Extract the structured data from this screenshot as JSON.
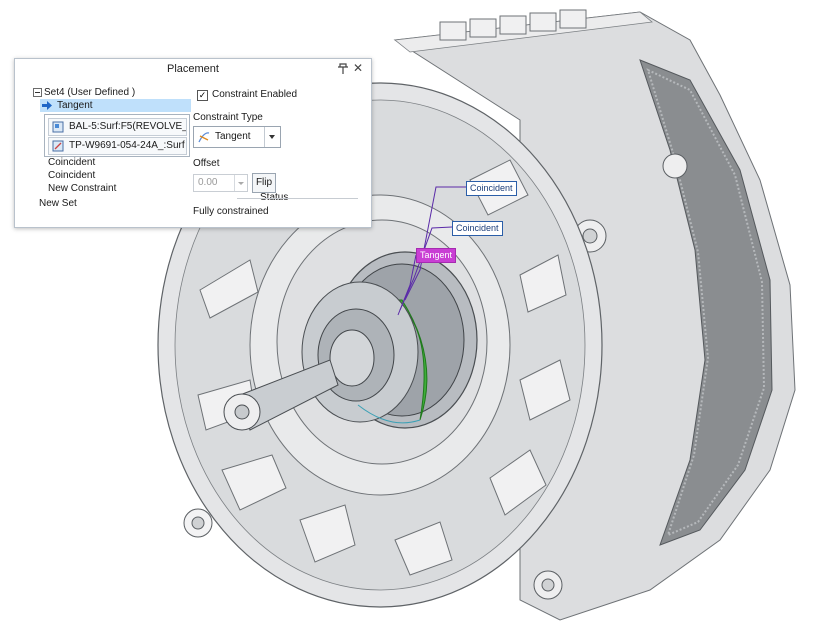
{
  "panel": {
    "title": "Placement",
    "tree": {
      "set_label": "Set4 (User Defined )",
      "selected_constraint": "Tangent",
      "references": [
        "BAL-5:Surf:F5(REVOLVE_",
        "TP-W9691-054-24A_:Surf"
      ],
      "other_constraints": [
        "Coincident",
        "Coincident",
        "New Constraint"
      ],
      "new_set": "New Set"
    },
    "constraint_enabled": {
      "label": "Constraint Enabled",
      "checked": true
    },
    "constraint_type": {
      "label": "Constraint Type",
      "value": "Tangent"
    },
    "offset": {
      "label": "Offset",
      "value": "0.00",
      "flip_label": "Flip"
    },
    "status": {
      "label": "Status",
      "value": "Fully constrained"
    }
  },
  "viewport": {
    "annotations": [
      {
        "label": "Coincident",
        "color": "#2b5ea8"
      },
      {
        "label": "Coincident",
        "color": "#2b5ea8"
      },
      {
        "label": "Tangent",
        "color": "#c93ed4"
      }
    ]
  },
  "colors": {
    "selection_highlight": "#bfe0fb",
    "surface_green": "#3fae3a",
    "surface_orange": "#f29a26",
    "model_gray": "#d8dadc"
  }
}
